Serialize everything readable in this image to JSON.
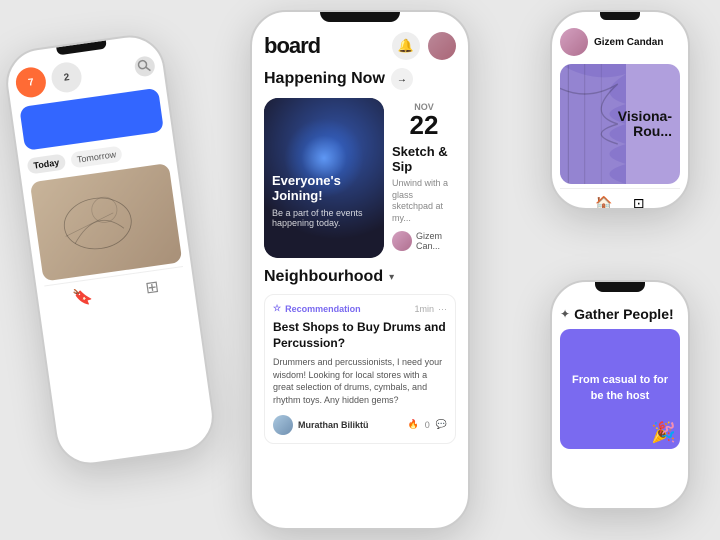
{
  "app": {
    "title": "board"
  },
  "center_phone": {
    "header": {
      "title": "board",
      "bell_icon": "🔔",
      "avatar_icon": "👤"
    },
    "happening_now": {
      "label": "Happening Now",
      "arrow": "→",
      "card": {
        "title": "Everyone's Joining!",
        "subtitle": "Be a part of the events happening today."
      },
      "event": {
        "month": "NOV",
        "day": "22",
        "name": "Sketch & Sip",
        "description": "Unwind with a glass sketchpad at my...",
        "host": "Gizem Can..."
      }
    },
    "neighbourhood": {
      "label": "Neighbourhood",
      "dropdown": "▾",
      "post": {
        "badge": "Recommendation",
        "time": "1min",
        "more": "···",
        "title": "Best Shops to Buy Drums and Percussion?",
        "body": "Drummers and percussionists, I need your wisdom! Looking for local stores with a great selection of drums, cymbals, and rhythm toys. Any hidden gems?",
        "author": "Murathan Biliktü",
        "actions": {
          "fire": "🔥",
          "count": "0",
          "comment": "💬"
        }
      }
    }
  },
  "left_phone": {
    "notifications": {
      "count1": "7",
      "count2": "2"
    },
    "tabs": {
      "today": "Today",
      "tomorrow": "Tomorrow"
    },
    "bottom_nav": {
      "bookmark": "🔖",
      "grid": "⊞"
    }
  },
  "right_top_phone": {
    "profile_name": "Gizem Candan",
    "card_title": "Visiona-\nRou..."
  },
  "right_bottom_phone": {
    "gather_title": "Gather People!",
    "casual_text": "From casual to for be the host"
  }
}
